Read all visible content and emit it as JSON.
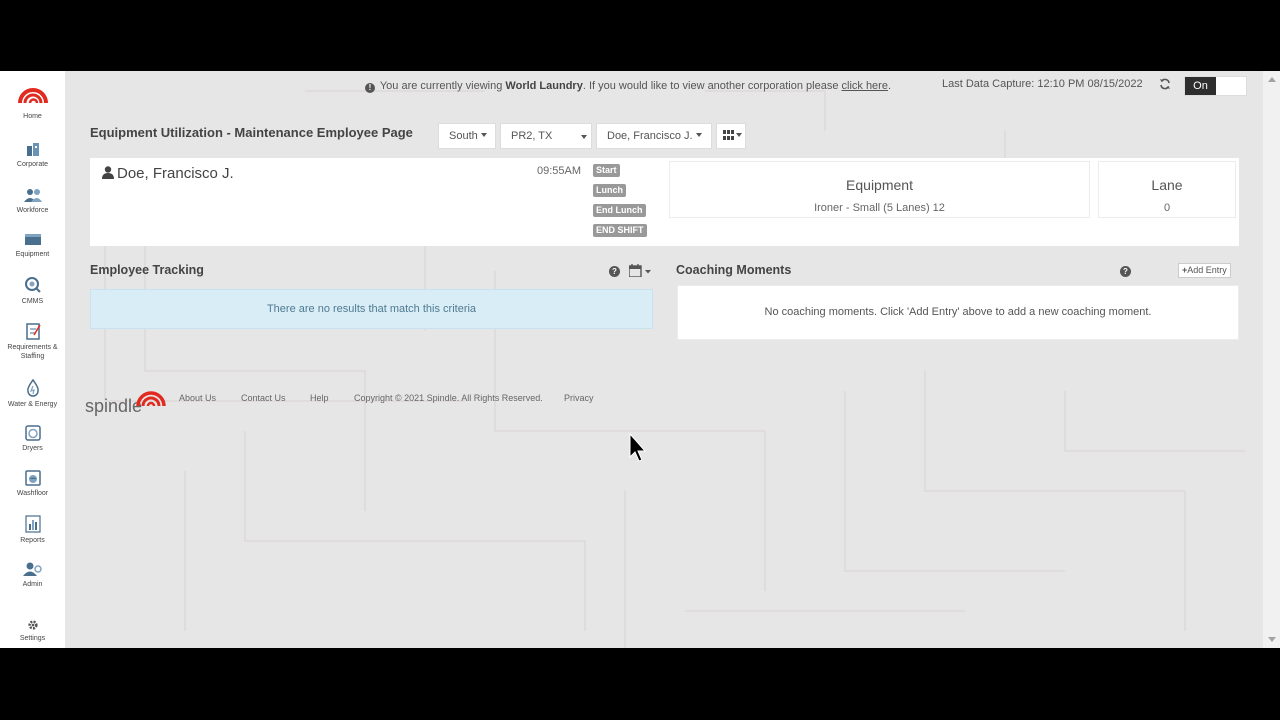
{
  "sidebar": {
    "items": [
      {
        "label": "Home",
        "icon": "spindle-logo-icon"
      },
      {
        "label": "Corporate",
        "icon": "corporate-icon"
      },
      {
        "label": "Workforce",
        "icon": "workforce-icon"
      },
      {
        "label": "Equipment",
        "icon": "equipment-icon"
      },
      {
        "label": "CMMS",
        "icon": "cmms-icon"
      },
      {
        "label": "Requirements & Staffing",
        "icon": "requirements-icon"
      },
      {
        "label": "Water & Energy",
        "icon": "water-energy-icon"
      },
      {
        "label": "Dryers",
        "icon": "dryers-icon"
      },
      {
        "label": "Washfloor",
        "icon": "washfloor-icon"
      },
      {
        "label": "Reports",
        "icon": "reports-icon"
      },
      {
        "label": "Admin",
        "icon": "admin-icon"
      },
      {
        "label": "Settings",
        "icon": "gear-icon"
      }
    ]
  },
  "notice": {
    "prefix": "You are currently viewing ",
    "corporation": "World Laundry",
    "suffix": ". If you would like to view another corporation please ",
    "link": "click here",
    "end": "."
  },
  "last_capture": "Last Data Capture: 12:10 PM 08/15/2022",
  "toggle": {
    "on_label": "On"
  },
  "header": {
    "title": "Equipment Utilization - Maintenance Employee Page",
    "region": "South",
    "plant": "PR2, TX",
    "employee": "Doe, Francisco J."
  },
  "employee": {
    "name": "Doe, Francisco J.",
    "time": "09:55AM",
    "badges": [
      "Start",
      "Lunch",
      "End Lunch",
      "END SHIFT"
    ],
    "equipment_label": "Equipment",
    "equipment_value": "Ironer - Small (5 Lanes) 12",
    "lane_label": "Lane",
    "lane_value": "0"
  },
  "tracking": {
    "title": "Employee Tracking",
    "empty": "There are no results that match this criteria"
  },
  "coaching": {
    "title": "Coaching Moments",
    "add_label": "Add Entry",
    "empty": "No coaching moments.  Click 'Add Entry' above to add a new coaching moment."
  },
  "footer": {
    "logo_text": "spindle",
    "links": [
      "About Us",
      "Contact Us",
      "Help",
      "Copyright © 2021 Spindle. All Rights Reserved.",
      "Privacy"
    ]
  },
  "help_button": "?",
  "colors": {
    "brand_red": "#e12a20",
    "info_bg": "#d9edf6",
    "badge_gray": "#999999"
  }
}
